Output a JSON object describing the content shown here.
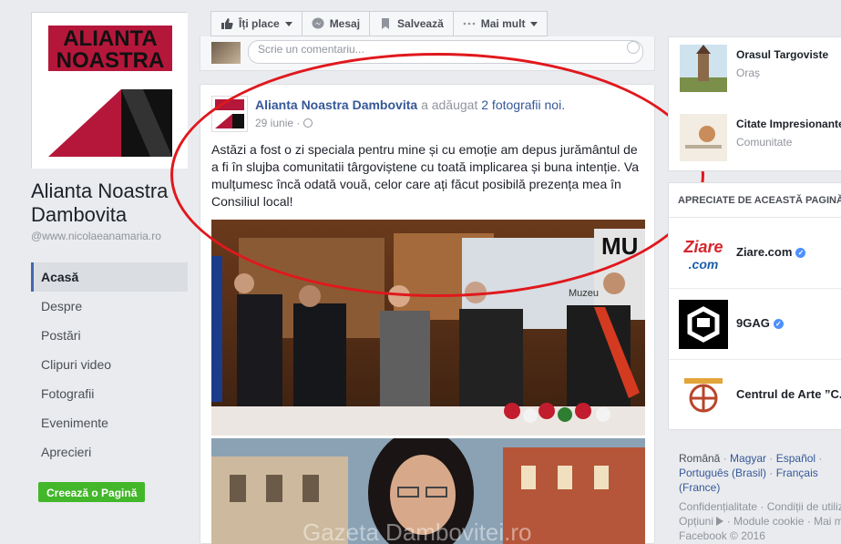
{
  "page": {
    "name": "Alianta Noastra Dambovita",
    "handle": "@www.nicolaeanamaria.ro",
    "logo_text_line1": "ALIANTA",
    "logo_text_line2": "NOASTRA"
  },
  "nav": {
    "items": [
      {
        "label": "Acasă",
        "active": true
      },
      {
        "label": "Despre"
      },
      {
        "label": "Postări"
      },
      {
        "label": "Clipuri video"
      },
      {
        "label": "Fotografii"
      },
      {
        "label": "Evenimente"
      },
      {
        "label": "Aprecieri"
      }
    ],
    "create_page": "Creează o Pagină"
  },
  "actions": {
    "like": "Îți place",
    "message": "Mesaj",
    "save": "Salvează",
    "more": "Mai mult"
  },
  "prev_post": {
    "comment_placeholder": "Scrie un comentariu..."
  },
  "post": {
    "author": "Alianta Noastra Dambovita",
    "action_text": "a adăugat",
    "photos_link": "2 fotografii noi.",
    "date": "29 iunie",
    "separator": "·",
    "text": "Astăzi a fost o zi speciala pentru mine și cu emoție am depus jurământul de a fi în slujba comunitatii târgoviștene cu toată implicarea și buna intenție. Va mulțumesc încă odată vouă, celor care ați făcut posibilă prezența mea în Consiliul local!",
    "photo1_sign": "MU",
    "photo1_sign2": "Muzeu",
    "watermark": "Gazeta Dambovitei.ro"
  },
  "right_top": {
    "items": [
      {
        "name": "Orasul Targoviste",
        "category": "Oraș"
      },
      {
        "name": "Citate Impresionante",
        "category": "Comunitate"
      }
    ]
  },
  "liked": {
    "header": "APRECIATE DE ACEASTĂ PAGINĂ",
    "items": [
      {
        "name": "Ziare.com",
        "verified": true,
        "logo_line1": "Ziare",
        "logo_line2": ".com"
      },
      {
        "name": "9GAG",
        "verified": true
      },
      {
        "name": "Centrul de Arte ”C...",
        "verified": false
      }
    ]
  },
  "languages": {
    "items": [
      "Română",
      "Magyar",
      "Español",
      "Português (Brasil)",
      "Français (France)"
    ]
  },
  "footer": {
    "line1": "Confidențialitate · Condiții de utilizare",
    "line2_a": "Opțiuni",
    "line2_b": "· Module cookie · Mai mult",
    "line3": "Facebook © 2016"
  },
  "colors": {
    "fb_blue": "#4267b2",
    "link_blue": "#365899",
    "create_green": "#42b72a",
    "annotation_red": "#e0181d",
    "logo_red": "#b5173a"
  }
}
